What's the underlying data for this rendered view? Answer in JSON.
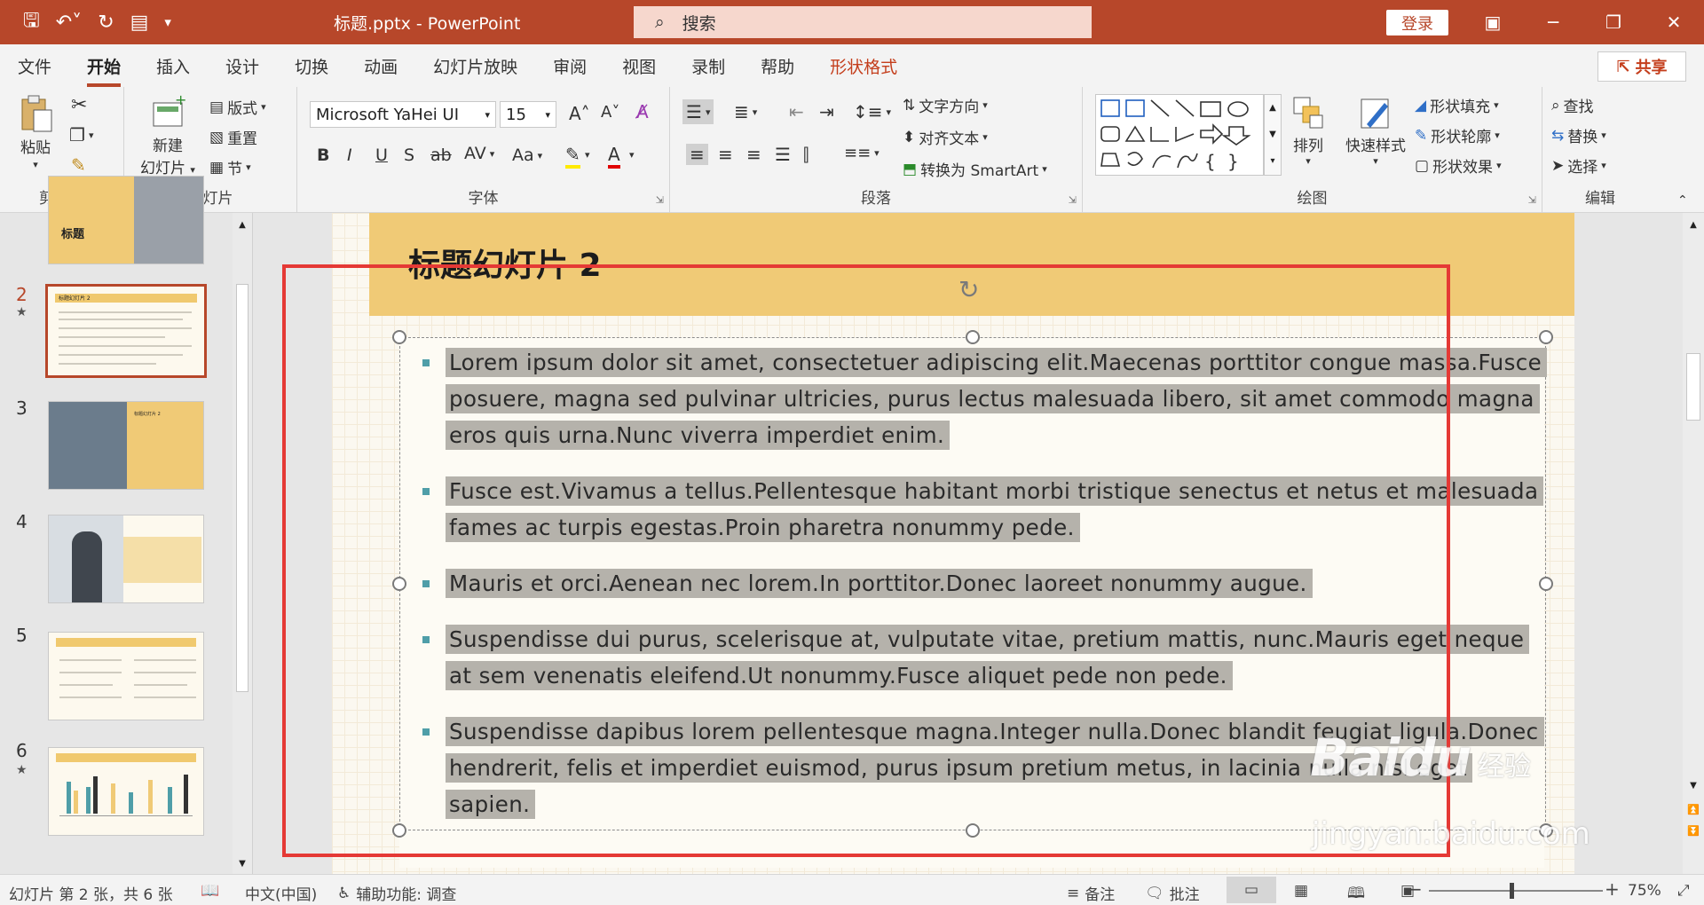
{
  "titlebar": {
    "doc_title": "标题.pptx  -  PowerPoint",
    "search_placeholder": "搜索",
    "login": "登录"
  },
  "tabs": [
    "文件",
    "开始",
    "插入",
    "设计",
    "切换",
    "动画",
    "幻灯片放映",
    "审阅",
    "视图",
    "录制",
    "帮助",
    "形状格式"
  ],
  "share": "共享",
  "ribbon": {
    "clipboard": {
      "label": "剪贴板",
      "paste": "粘贴"
    },
    "slides": {
      "label": "幻灯片",
      "new_slide_1": "新建",
      "new_slide_2": "幻灯片",
      "layout": "版式",
      "reset": "重置",
      "section": "节"
    },
    "font": {
      "label": "字体",
      "font_name": "Microsoft YaHei UI",
      "font_size": "15"
    },
    "paragraph": {
      "label": "段落",
      "text_direction": "文字方向",
      "align_text": "对齐文本",
      "smartart": "转换为 SmartArt"
    },
    "drawing": {
      "label": "绘图",
      "arrange": "排列",
      "quick_styles": "快速样式",
      "shape_fill": "形状填充",
      "shape_outline": "形状轮廓",
      "shape_effects": "形状效果"
    },
    "editing": {
      "label": "编辑",
      "find": "查找",
      "replace": "替换",
      "select": "选择"
    }
  },
  "thumbnails": {
    "numbers": [
      "2",
      "3",
      "4",
      "5",
      "6"
    ],
    "partial_title": "标题",
    "mini_title": "标题幻灯片 2"
  },
  "slide": {
    "title": "标题幻灯片 2",
    "bullets": [
      "Lorem ipsum dolor sit amet, consectetuer adipiscing elit.Maecenas porttitor congue massa.Fusce posuere, magna sed pulvinar ultricies, purus lectus malesuada libero, sit amet commodo magna eros quis urna.Nunc viverra imperdiet enim.",
      "Fusce est.Vivamus a tellus.Pellentesque habitant morbi tristique senectus et netus et malesuada fames ac turpis egestas.Proin pharetra nonummy pede.",
      "Mauris et orci.Aenean nec lorem.In porttitor.Donec laoreet nonummy augue.",
      "Suspendisse dui purus, scelerisque at, vulputate vitae, pretium mattis, nunc.Mauris eget neque at sem venenatis eleifend.Ut nonummy.Fusce aliquet pede non pede.",
      "Suspendisse dapibus lorem pellentesque magna.Integer nulla.Donec blandit feugiat ligula.Donec hendrerit, felis et imperdiet euismod, purus ipsum pretium metus, in lacinia nulla nisl eget sapien."
    ]
  },
  "status": {
    "slide_count": "幻灯片 第 2 张，共 6 张",
    "language": "中文(中国)",
    "accessibility": "辅助功能: 调查",
    "notes": "备注",
    "comments": "批注",
    "zoom": "75%"
  },
  "watermark": {
    "brand": "Baidu",
    "suffix": "经验",
    "url": "jingyan.baidu.com"
  },
  "colors": {
    "accent": "#b7472a",
    "title_band": "#f0ca76",
    "highlight": "#b5b2ab",
    "annotation": "#e53935"
  }
}
